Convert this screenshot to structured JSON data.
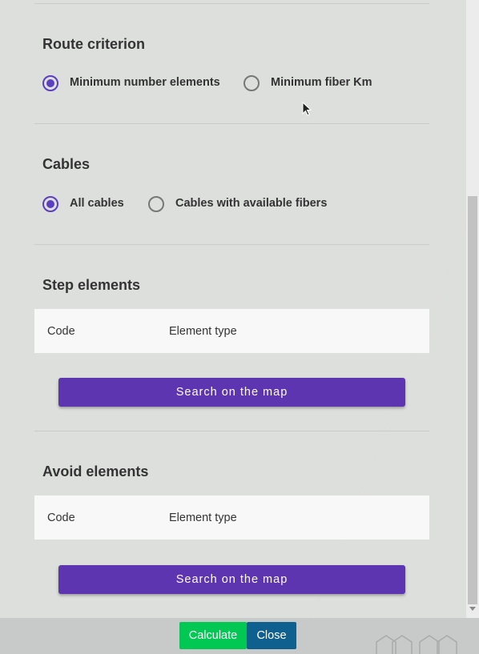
{
  "route": {
    "title": "Route criterion",
    "options": [
      {
        "label": "Minimum number elements",
        "checked": true
      },
      {
        "label": "Minimum fiber Km",
        "checked": false
      }
    ]
  },
  "cables": {
    "title": "Cables",
    "options": [
      {
        "label": "All cables",
        "checked": true
      },
      {
        "label": "Cables with available fibers",
        "checked": false
      }
    ]
  },
  "step_elements": {
    "title": "Step elements",
    "columns": [
      "Code",
      "Element type"
    ],
    "search_label": "Search on the map"
  },
  "avoid_elements": {
    "title": "Avoid elements",
    "columns": [
      "Code",
      "Element type"
    ],
    "search_label": "Search on the map"
  },
  "footer": {
    "calculate_label": "Calculate",
    "close_label": "Close"
  },
  "colors": {
    "accent": "#5e35b1",
    "calculate": "#00c853",
    "close": "#0f5f8f"
  }
}
